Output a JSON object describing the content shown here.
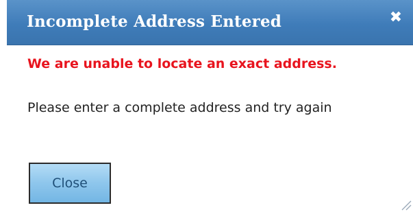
{
  "dialog": {
    "title": "Incomplete Address Entered",
    "close_icon": "close-icon",
    "close_glyph": "✖",
    "error_message": "We are unable to locate an exact address.",
    "info_message": "Please enter a complete address and try again",
    "close_button_label": "Close"
  },
  "colors": {
    "titlebar": "#3f7cb9",
    "error_text": "#e8141e",
    "button_fill": "#8ec6ec"
  }
}
